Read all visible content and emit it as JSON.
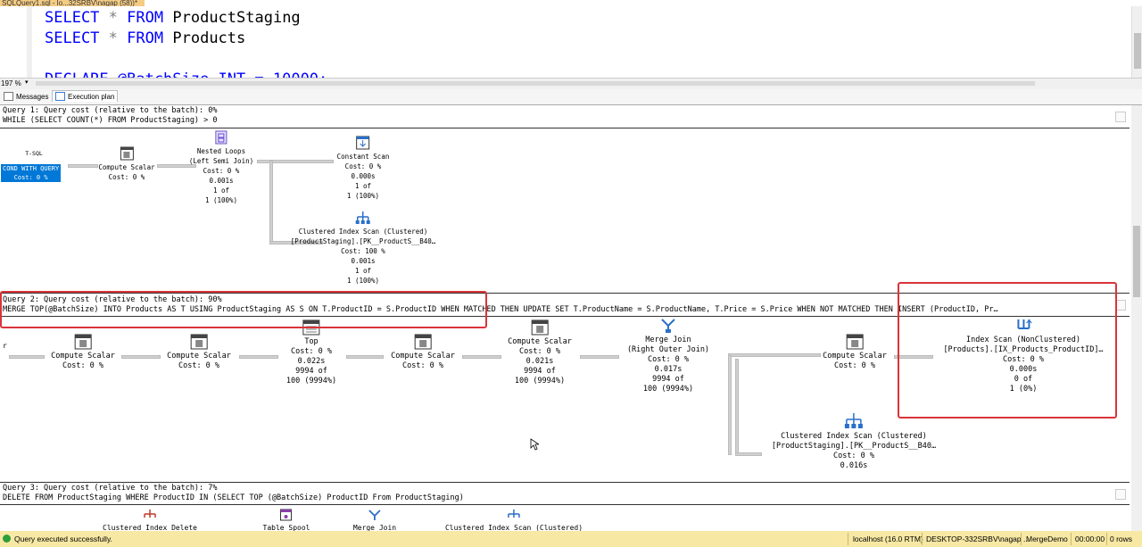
{
  "document_tab": {
    "title": "SQLQuery1.sql - lo...32SRBV\\nagap (58))*"
  },
  "editor": {
    "lines": [
      {
        "kw1": "SELECT",
        "op": "*",
        "kw2": "FROM",
        "table": "ProductStaging"
      },
      {
        "kw1": "SELECT",
        "op": "*",
        "kw2": "FROM",
        "table": "Products"
      }
    ],
    "partial_line": "DECLARE @BatchSize INT = 10000;"
  },
  "zoom": {
    "value": "197 %",
    "dropdown": "▾"
  },
  "result_tabs": {
    "messages": "Messages",
    "execution_plan": "Execution plan"
  },
  "query1": {
    "header": "Query 1: Query cost (relative to the batch): 0%",
    "statement": "WHILE (SELECT COUNT(*) FROM ProductStaging) > 0",
    "tsql_label": "T-SQL",
    "root": {
      "line1": "COND WITH QUERY",
      "line2": "Cost: 0 %"
    },
    "compute_scalar": {
      "name": "Compute Scalar",
      "cost": "Cost: 0 %"
    },
    "nested_loops": {
      "name": "Nested Loops",
      "sub": "(Left Semi Join)",
      "cost": "Cost: 0 %",
      "time": "0.001s",
      "rows": "1 of",
      "est": "1 (100%)"
    },
    "constant_scan": {
      "name": "Constant Scan",
      "cost": "Cost: 0 %",
      "time": "0.000s",
      "rows": "1 of",
      "est": "1 (100%)"
    },
    "clustered_scan": {
      "name": "Clustered Index Scan (Clustered)",
      "object": "[ProductStaging].[PK__ProductS__B40…",
      "cost": "Cost: 100 %",
      "time": "0.001s",
      "rows": "1 of",
      "est": "1 (100%)"
    }
  },
  "query2": {
    "header": "Query 2: Query cost (relative to the batch): 90%",
    "statement": "MERGE TOP(@BatchSize) INTO Products AS T USING ProductStaging AS S ON T.ProductID = S.ProductID WHEN MATCHED THEN UPDATE SET T.ProductName = S.ProductName, T.Price = S.Price WHEN NOT MATCHED THEN INSERT (ProductID, Pr…",
    "edge_label": "r",
    "cs1": {
      "name": "Compute Scalar",
      "cost": "Cost: 0 %"
    },
    "cs2": {
      "name": "Compute Scalar",
      "cost": "Cost: 0 %"
    },
    "top": {
      "name": "Top",
      "cost": "Cost: 0 %",
      "time": "0.022s",
      "rows": "9994 of",
      "est": "100 (9994%)"
    },
    "cs3": {
      "name": "Compute Scalar",
      "cost": "Cost: 0 %"
    },
    "cs4": {
      "name": "Compute Scalar",
      "cost": "Cost: 0 %",
      "time": "0.021s",
      "rows": "9994 of",
      "est": "100 (9994%)"
    },
    "merge_join": {
      "name": "Merge Join",
      "sub": "(Right Outer Join)",
      "cost": "Cost: 0 %",
      "time": "0.017s",
      "rows": "9994 of",
      "est": "100 (9994%)"
    },
    "cs5": {
      "name": "Compute Scalar",
      "cost": "Cost: 0 %"
    },
    "index_scan": {
      "name": "Index Scan (NonClustered)",
      "object": "[Products].[IX_Products_ProductID]…",
      "cost": "Cost: 0 %",
      "time": "0.000s",
      "rows": "0 of",
      "est": "1 (0%)"
    },
    "clustered_scan": {
      "name": "Clustered Index Scan (Clustered)",
      "object": "[ProductStaging].[PK__ProductS__B40…",
      "cost": "Cost: 0 %",
      "time": "0.016s"
    }
  },
  "query3": {
    "header": "Query 3: Query cost (relative to the batch): 7%",
    "statement": "DELETE FROM ProductStaging WHERE ProductID IN (SELECT TOP (@BatchSize) ProductID From ProductStaging)",
    "nodes": [
      "Clustered Index Delete",
      "Table Spool",
      "Merge Join",
      "Clustered Index Scan (Clustered)"
    ]
  },
  "status": {
    "message": "Query executed successfully.",
    "server": "localhost (16.0 RTM)",
    "user": "DESKTOP-332SRBV\\nagap ...",
    "database": "MergeDemo",
    "elapsed": "00:00:00",
    "rows": "0 rows"
  },
  "colors": {
    "keyword": "#0000ff",
    "highlight": "#d9343a",
    "status_bar": "#f7e8a4",
    "selection": "#0078d7"
  }
}
